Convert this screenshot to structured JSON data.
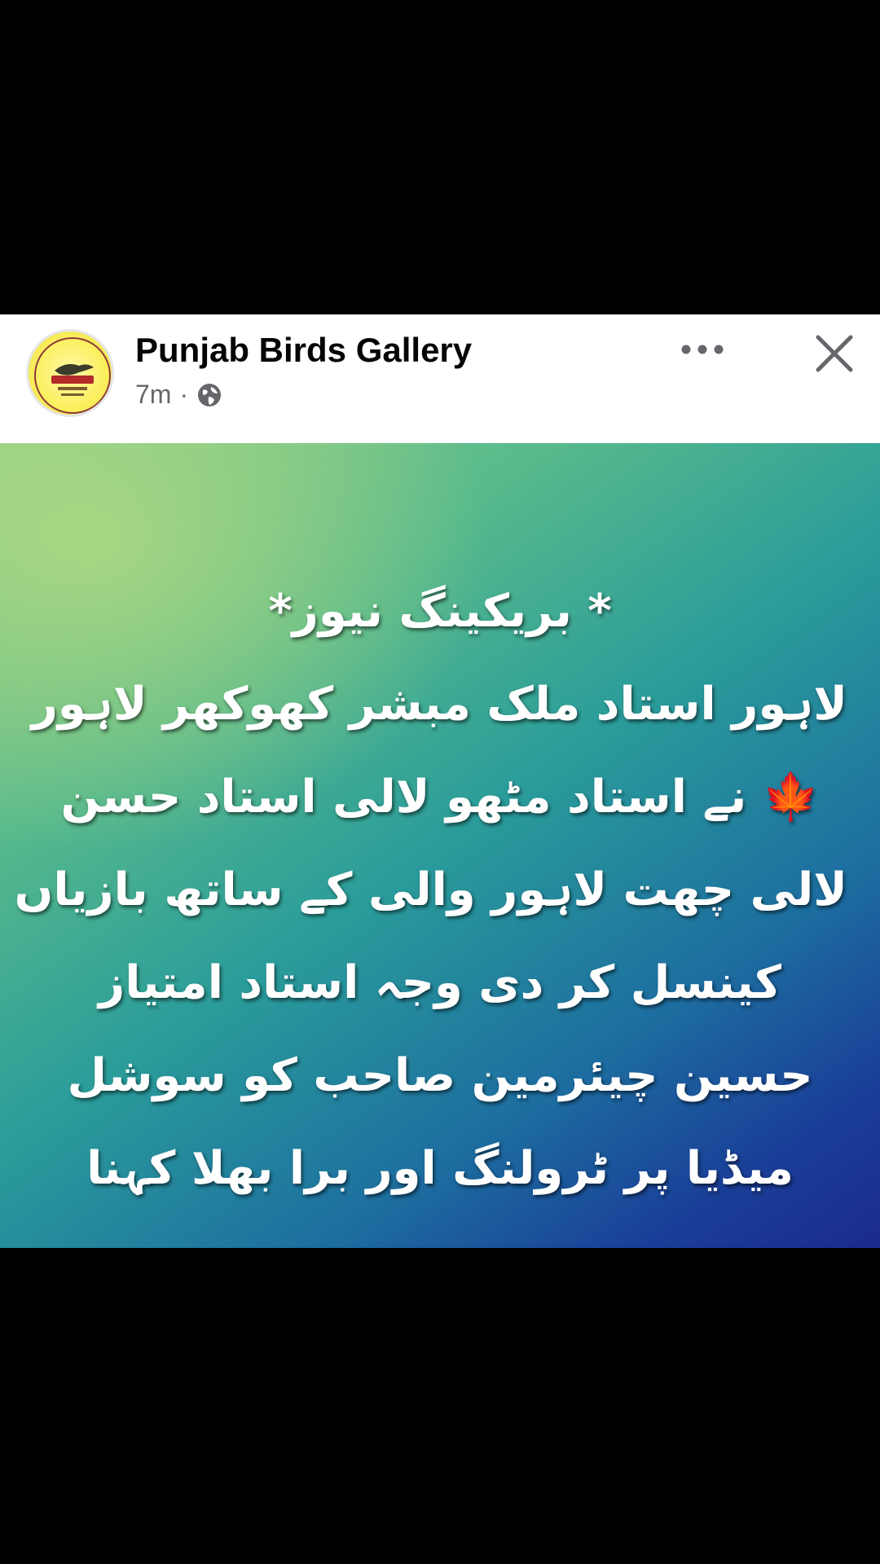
{
  "post": {
    "author": "Punjab Birds Gallery",
    "time": "7m",
    "separator": "·",
    "visibility_icon": "globe-icon",
    "avatar_logo_text": "Punjab Birds Gallery Lahore",
    "more_icon": "more-options-icon",
    "close_icon": "close-icon"
  },
  "image_text": {
    "lines": [
      "* بریکینگ نیوز*",
      "لاہور استاد ملک مبشر کھوکھر لاہور",
      "نے استاد مٹھو لالی استاد حسن",
      "لالی چھت لاہور والی کے ساتھ بازیاں",
      "کینسل کر دی وجہ استاد امتیاز",
      "حسین چیئرمین صاحب کو سوشل",
      "میڈیا پر ٹرولنگ اور برا بھلا کہنا"
    ],
    "leaf_emoji": "🍁"
  },
  "colors": {
    "header_bg": "#ffffff",
    "text_primary": "#050505",
    "text_secondary": "#65676b",
    "gradient_start": "#8fcf86",
    "gradient_end": "#1b2a8c"
  }
}
